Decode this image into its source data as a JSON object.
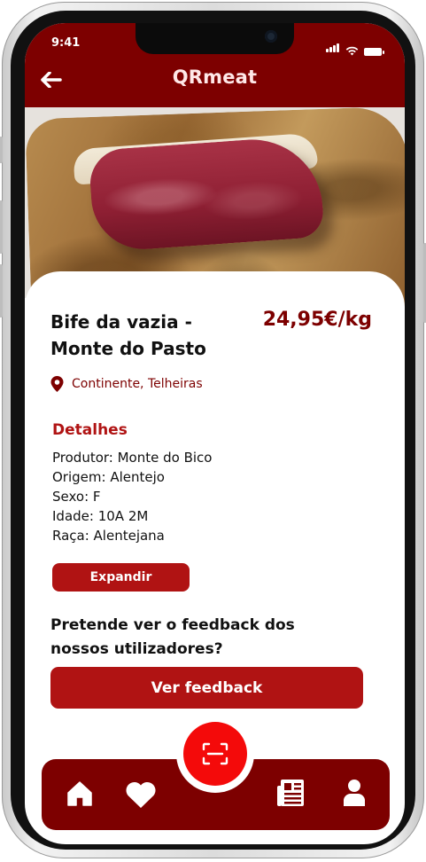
{
  "status_bar": {
    "time": "9:41"
  },
  "header": {
    "title": "QRmeat"
  },
  "product": {
    "name": "Bife da vazia - Monte do Pasto",
    "price": "24,95€/kg",
    "location": "Continente, Telheiras"
  },
  "details": {
    "title": "Detalhes",
    "lines": [
      "Produtor: Monte do Bico",
      "Origem: Alentejo",
      "Sexo: F",
      "Idade: 10A 2M",
      "Raça: Alentejana"
    ],
    "expand_label": "Expandir"
  },
  "feedback": {
    "question": "Pretende ver o feedback dos nossos utilizadores?",
    "button_label": "Ver feedback"
  },
  "nav": {
    "items": [
      "home-icon",
      "heart-icon",
      "scan-icon",
      "news-icon",
      "user-icon"
    ]
  },
  "colors": {
    "primary": "#7d0000",
    "accent": "#b01313",
    "scan": "#f40a0a"
  }
}
